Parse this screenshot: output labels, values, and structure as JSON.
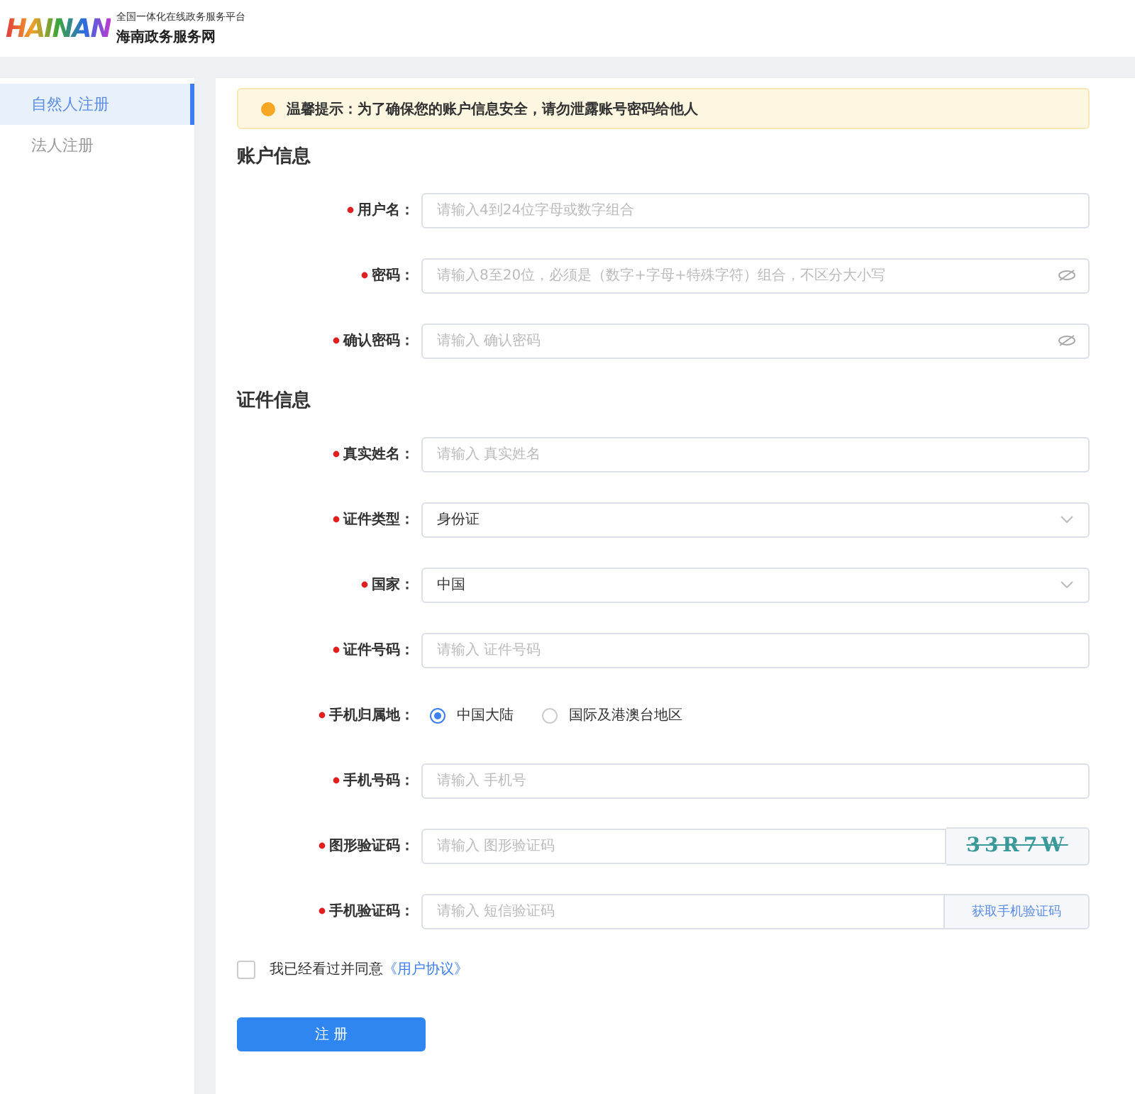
{
  "header": {
    "logo": "HAINAN",
    "platform": "全国一体化在线政务服务平台",
    "site": "海南政务服务网"
  },
  "sidebar": {
    "items": [
      {
        "label": "自然人注册",
        "selected": true
      },
      {
        "label": "法人注册",
        "selected": false
      }
    ]
  },
  "notice": "温馨提示：为了确保您的账户信息安全，请勿泄露账号密码给他人",
  "sections": [
    {
      "title": "账户信息",
      "fields": [
        {
          "kind": "text",
          "label": "用户名：",
          "required": true,
          "placeholder": "请输入4到24位字母或数字组合"
        },
        {
          "kind": "password",
          "label": "密码：",
          "required": true,
          "placeholder": "请输入8至20位，必须是（数字+字母+特殊字符）组合，不区分大小写"
        },
        {
          "kind": "password",
          "label": "确认密码：",
          "required": true,
          "placeholder": "请输入 确认密码"
        }
      ]
    },
    {
      "title": "证件信息",
      "fields": [
        {
          "kind": "text",
          "label": "真实姓名：",
          "required": true,
          "placeholder": "请输入 真实姓名"
        },
        {
          "kind": "select",
          "label": "证件类型：",
          "required": true,
          "value": "身份证"
        },
        {
          "kind": "select",
          "label": "国家：",
          "required": true,
          "value": "中国"
        },
        {
          "kind": "text",
          "label": "证件号码：",
          "required": true,
          "placeholder": "请输入 证件号码"
        },
        {
          "kind": "radio",
          "label": "手机归属地：",
          "required": true,
          "options": [
            {
              "label": "中国大陆",
              "selected": true
            },
            {
              "label": "国际及港澳台地区",
              "selected": false
            }
          ]
        },
        {
          "kind": "text",
          "label": "手机号码：",
          "required": true,
          "placeholder": "请输入 手机号"
        },
        {
          "kind": "captcha",
          "label": "图形验证码：",
          "required": true,
          "placeholder": "请输入 图形验证码",
          "captcha": "33R7W"
        },
        {
          "kind": "sms",
          "label": "手机验证码：",
          "required": true,
          "placeholder": "请输入 短信验证码",
          "button": "获取手机验证码"
        }
      ]
    }
  ],
  "agreement": {
    "checked": false,
    "text": "我已经看过并同意",
    "link": "《用户协议》"
  },
  "submit": "注 册"
}
